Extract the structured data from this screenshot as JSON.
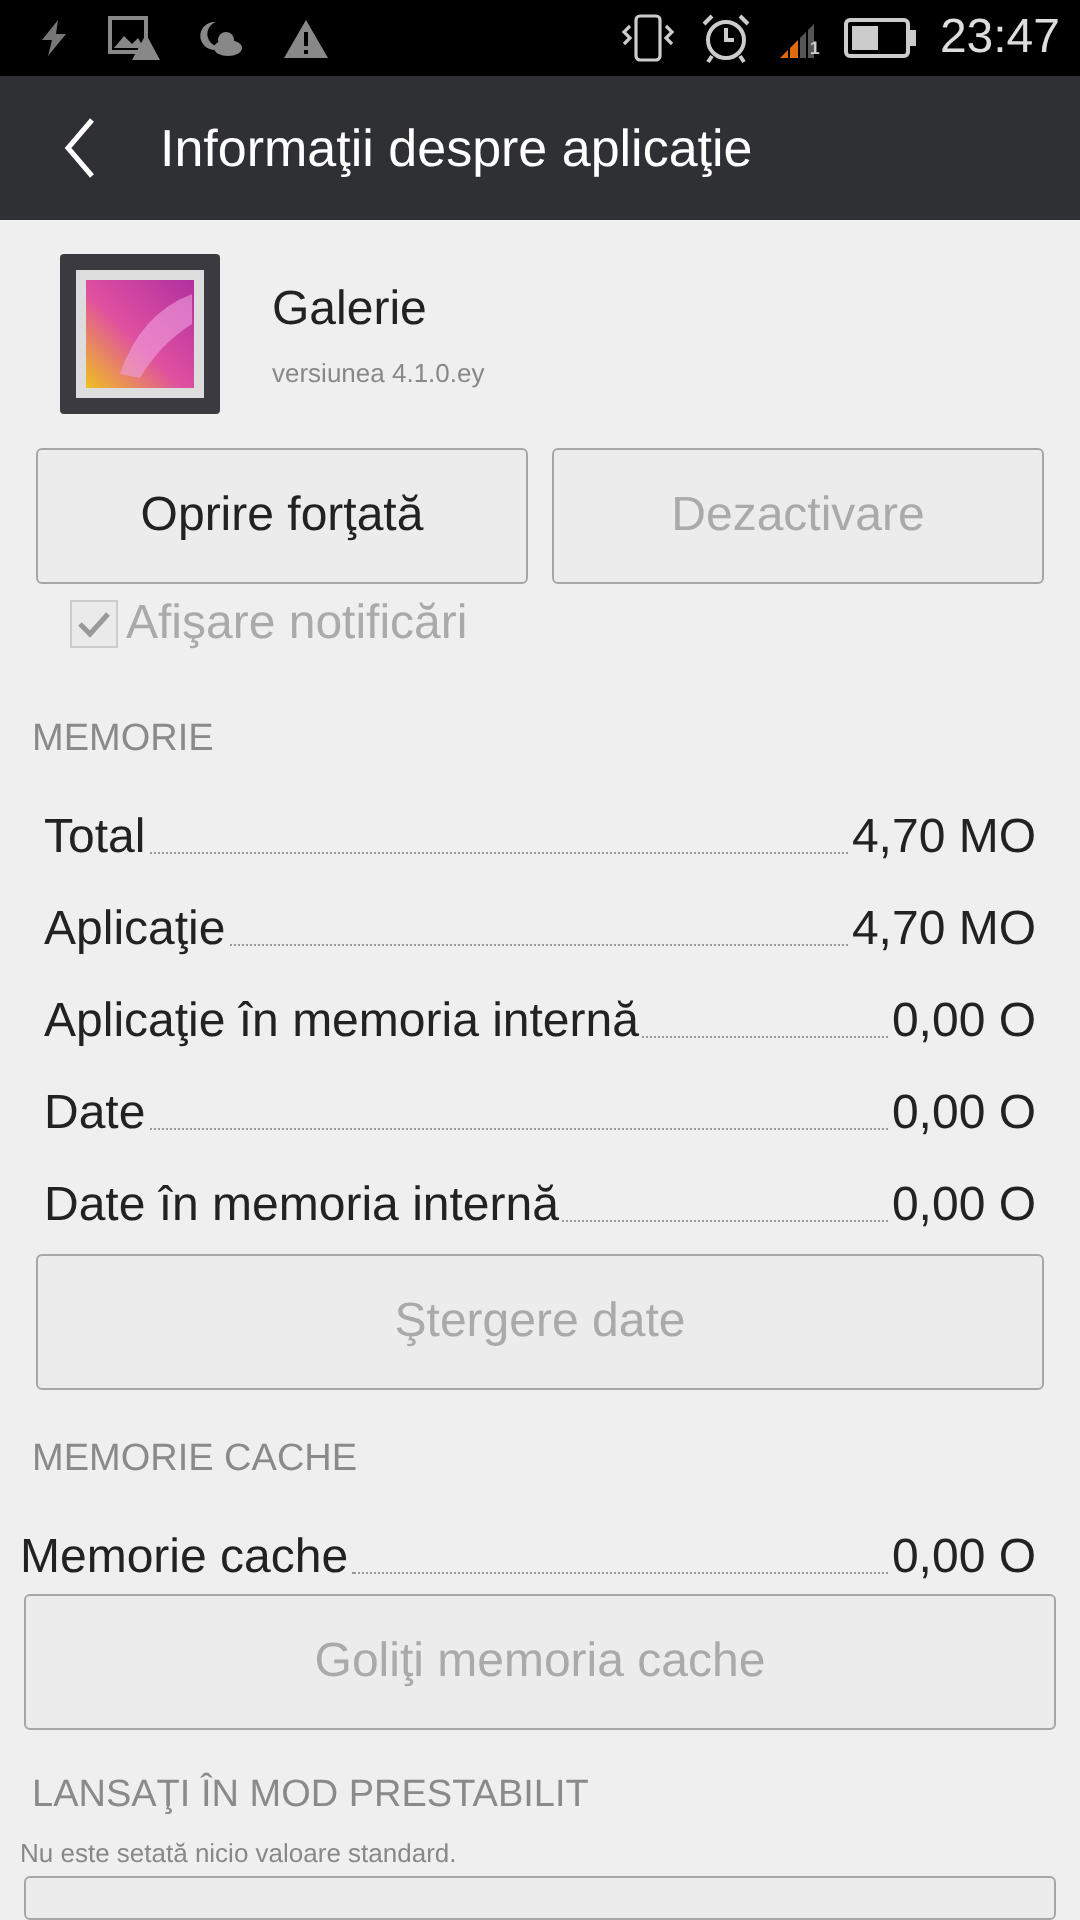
{
  "status_bar": {
    "time": "23:47",
    "sim_label": "1"
  },
  "title_bar": {
    "title": "Informaţii despre aplicaţie"
  },
  "app": {
    "name": "Galerie",
    "version": "versiunea 4.1.0.ey"
  },
  "buttons": [
    {
      "label": "Oprire forţată",
      "disabled": false
    },
    {
      "label": "Dezactivare",
      "disabled": true
    }
  ],
  "notifications": {
    "label": "Afişare notificări",
    "checked": true,
    "disabled": true
  },
  "sections": [
    {
      "title": "MEMORIE",
      "rows": [
        {
          "label": "Total",
          "value": "4,70 MO"
        },
        {
          "label": "Aplicaţie",
          "value": "4,70 MO"
        },
        {
          "label": "Aplicaţie în memoria internă",
          "value": "0,00 O"
        },
        {
          "label": "Date",
          "value": "0,00 O"
        },
        {
          "label": "Date în memoria internă",
          "value": "0,00 O"
        }
      ],
      "button": {
        "label": "Ştergere date",
        "disabled": true
      }
    },
    {
      "title": "MEMORIE CACHE",
      "rows": [
        {
          "label": "Memorie cache",
          "value": "0,00 O"
        }
      ],
      "button": {
        "label": "Goliţi memoria cache",
        "disabled": true
      }
    },
    {
      "title": "LANSAŢI ÎN MOD PRESTABILIT",
      "note": "Nu este setată nicio valoare standard."
    }
  ]
}
